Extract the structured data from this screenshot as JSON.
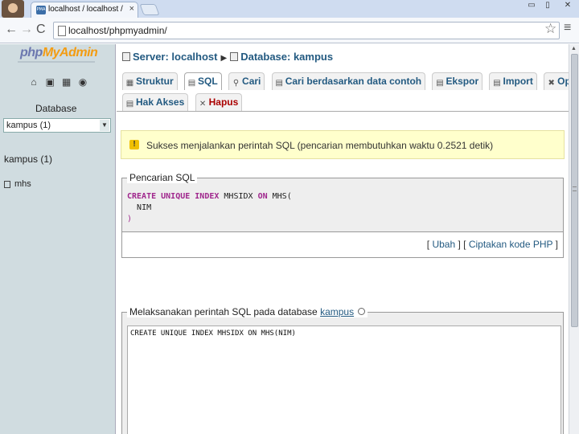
{
  "browser": {
    "tab_title": "localhost / localhost / kampus",
    "tab_favicon": "PMA",
    "tab_close": "×",
    "url": "localhost/phpmyadmin/",
    "window_controls": {
      "minimize": "▭",
      "maximize": "▯",
      "close": "✕"
    },
    "nav": {
      "back": "←",
      "forward": "→",
      "reload": "C"
    },
    "star": "☆",
    "menu": "≡"
  },
  "sidebar": {
    "logo_php": "php",
    "logo_myadmin": "MyAdmin",
    "icons": [
      "home-icon",
      "sql-query-icon",
      "docs-icon",
      "reload-icon"
    ],
    "icon_glyphs": [
      "⌂",
      "▣",
      "▦",
      "◉"
    ],
    "database_label": "Database",
    "database_select": "kampus (1)",
    "select_arrow": "▼",
    "tree_name": "kampus (1)",
    "tables": [
      "mhs"
    ]
  },
  "breadcrumb": {
    "server": "Server: localhost",
    "separator": "▶",
    "database": "Database: kampus"
  },
  "tabs_row1": [
    {
      "label": "Struktur",
      "icon": "▦"
    },
    {
      "label": "SQL",
      "icon": "▤"
    },
    {
      "label": "Cari",
      "icon": "⚲"
    },
    {
      "label": "Cari berdasarkan data contoh",
      "icon": "▤"
    },
    {
      "label": "Ekspor",
      "icon": "▤"
    },
    {
      "label": "Import",
      "icon": "▤"
    },
    {
      "label": "Operasi",
      "icon": "✖"
    }
  ],
  "tabs_row2": [
    {
      "label": "Hak Akses",
      "icon": "▤"
    },
    {
      "label": "Hapus",
      "icon": "✕"
    }
  ],
  "success": {
    "icon": "!",
    "message": "Sukses menjalankan perintah SQL (pencarian membutuhkan waktu 0.2521 detik)"
  },
  "sql_panel": {
    "legend": "Pencarian SQL",
    "keywords": "CREATE UNIQUE INDEX",
    "name_part": " MHSIDX ",
    "on_kw": "ON",
    "table_part": " MHS(",
    "column": "NIM",
    "close_paren": ")",
    "link_edit": "Ubah",
    "link_php": "Ciptakan kode PHP"
  },
  "run_panel": {
    "legend_prefix": "Melaksanakan perintah SQL pada database ",
    "legend_db": "kampus",
    "textarea_value": "CREATE UNIQUE INDEX MHSIDX ON MHS(NIM)"
  },
  "scrollbar": {
    "up_arrow": "▲",
    "grip": "≡"
  }
}
